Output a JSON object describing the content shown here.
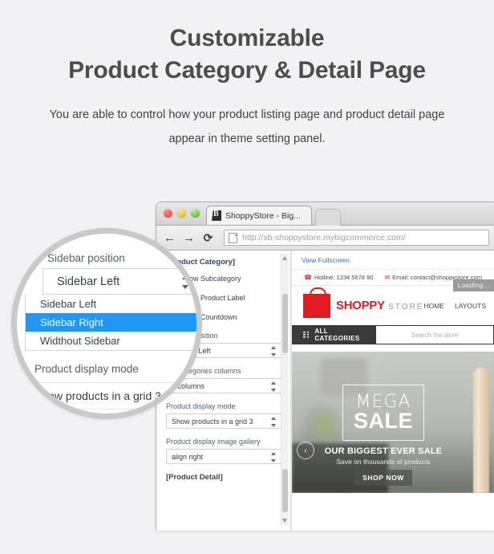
{
  "hero": {
    "title_line1": "Customizable",
    "title_line2": "Product Category & Detail Page",
    "subtitle_line1": "You are able to control how your product listing page and product detail page",
    "subtitle_line2": "appear in theme setting panel."
  },
  "browser": {
    "tab_title": "ShoppyStore - Big...",
    "url": "http://sb-shoppystore.mybigcommerce.com/",
    "back_icon": "←",
    "forward_icon": "→",
    "reload_icon": "⟳"
  },
  "settings_panel": {
    "section_category": "[Product Category]",
    "checkboxes": [
      {
        "label": "Show Subcategory",
        "checked": true
      },
      {
        "label": "Show Product Label",
        "checked": true
      },
      {
        "label": "Show Countdown",
        "checked": true
      }
    ],
    "fields": [
      {
        "label": "Sidebar position",
        "value": "Sidebar Left"
      },
      {
        "label": "Subcategories columns",
        "value": "5 columns"
      },
      {
        "label": "Product display mode",
        "value": "Show products in a grid 3"
      },
      {
        "label": "Product display image gallery",
        "value": "align right"
      }
    ],
    "section_detail": "[Product Detail]"
  },
  "preview": {
    "fullscreen_link": "View Fullscreen",
    "hotline": "Hotline: 1234 5678 90",
    "email": "Email: contact@shoppystore.com",
    "phone_icon": "☎",
    "mail_icon": "✉",
    "loading_badge": "Loading...",
    "logo_primary": "SHOPPY",
    "logo_secondary": "STORE",
    "nav": [
      "HOME",
      "LAYOUTS"
    ],
    "all_categories": "ALL CATEGORIES",
    "search_placeholder": "Search the store",
    "banner": {
      "mega": "MEGA",
      "sale": "SALE",
      "tagline": "OUR BIGGEST EVER SALE",
      "subline": "Save on thousands of products",
      "cta": "SHOP NOW",
      "prev_arrow": "‹"
    }
  },
  "lens": {
    "field_label": "Sidebar position",
    "selected_value": "Sidebar Left",
    "options": [
      {
        "label": "Sidebar Left",
        "selected": false
      },
      {
        "label": "Sidebar Right",
        "selected": true
      },
      {
        "label": "Widthout Sidebar",
        "selected": false
      }
    ],
    "mode_label": "Product display mode",
    "mode_value": "Show products in a grid 3"
  },
  "colors": {
    "page_background": "#f2f2f4",
    "heading": "#4d4d4d",
    "body_text": "#3f4249",
    "accent_blue": "#2196f3",
    "link_blue": "#3b6fd4",
    "brand_red": "#e11b22",
    "dark_bar": "#3a3a3a",
    "lens_ring": "#c9c9c9"
  }
}
